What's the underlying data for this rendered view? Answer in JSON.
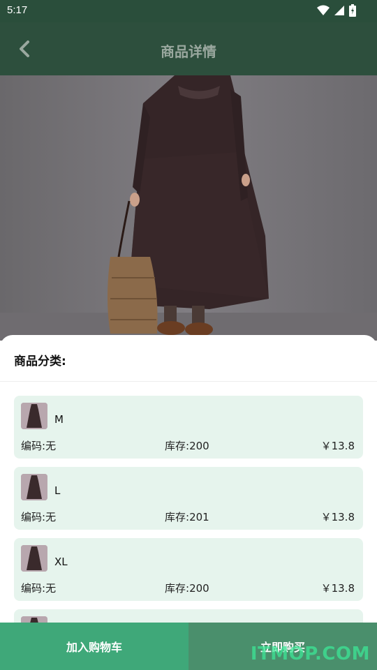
{
  "status": {
    "time": "5:17"
  },
  "appbar": {
    "title": "商品详情"
  },
  "sheet": {
    "title": "商品分类:",
    "variants": [
      {
        "size": "M",
        "code_label": "编码:",
        "code": "无",
        "stock_label": "库存:",
        "stock": "200",
        "price": "￥13.8"
      },
      {
        "size": "L",
        "code_label": "编码:",
        "code": "无",
        "stock_label": "库存:",
        "stock": "201",
        "price": "￥13.8"
      },
      {
        "size": "XL",
        "code_label": "编码:",
        "code": "无",
        "stock_label": "库存:",
        "stock": "200",
        "price": "￥13.8"
      }
    ]
  },
  "bottom": {
    "add_to_cart": "加入购物车",
    "buy_now": "立即购买"
  },
  "watermark": "ITMOP.COM",
  "colors": {
    "header": "#2d4f3d",
    "card": "#e6f4ed",
    "cart_button": "#3fa879",
    "buy_button": "#4a8f6c"
  }
}
